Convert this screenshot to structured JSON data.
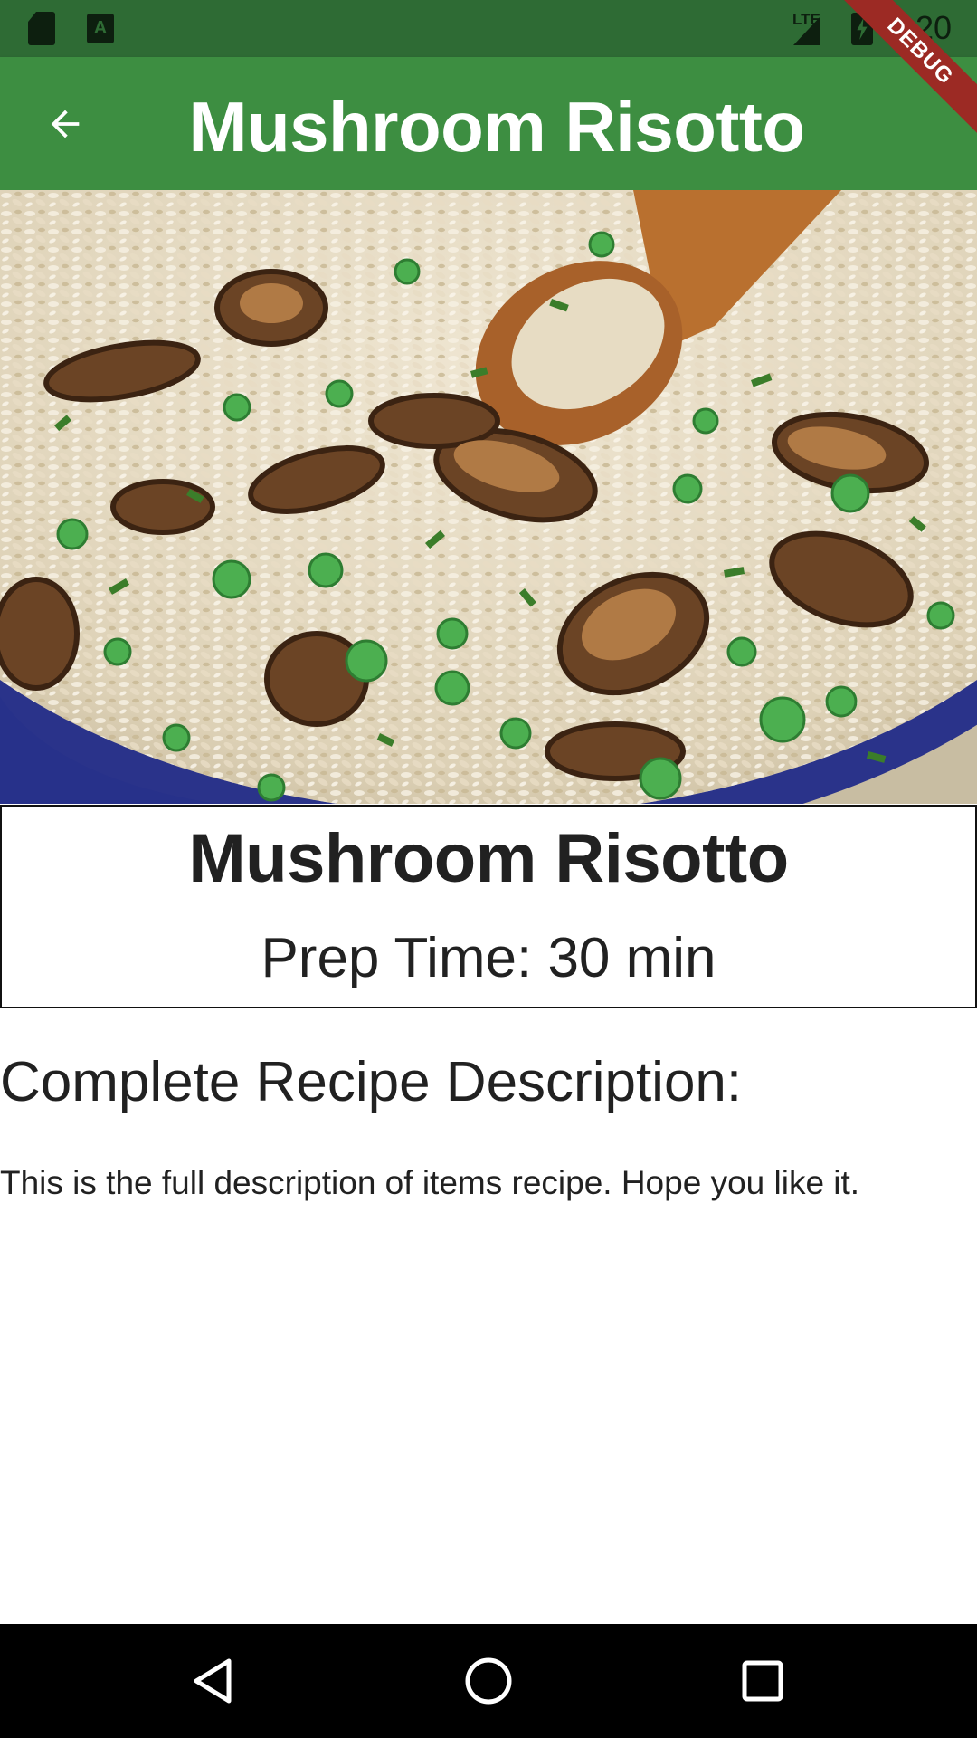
{
  "status_bar": {
    "network_label": "LTE",
    "time": "4:20",
    "icons": [
      "sd-card-icon",
      "a-notification-icon",
      "signal-icon",
      "battery-charging-icon"
    ]
  },
  "app_bar": {
    "title": "Mushroom Risotto",
    "back_icon": "arrow-back-icon",
    "background_color": "#3d8e41"
  },
  "debug_banner": {
    "label": "DEBUG",
    "color": "#9c2a24"
  },
  "hero": {
    "image_subject": "mushroom risotto in a blue pot with wooden spoon"
  },
  "card": {
    "title": "Mushroom Risotto",
    "prep_time": "Prep Time: 30 min"
  },
  "description_section": {
    "heading": "Complete Recipe Description:",
    "body": "This is the full description of items recipe. Hope you like it."
  },
  "nav_bar": {
    "icons": [
      "nav-back-icon",
      "nav-home-icon",
      "nav-recents-icon"
    ]
  }
}
